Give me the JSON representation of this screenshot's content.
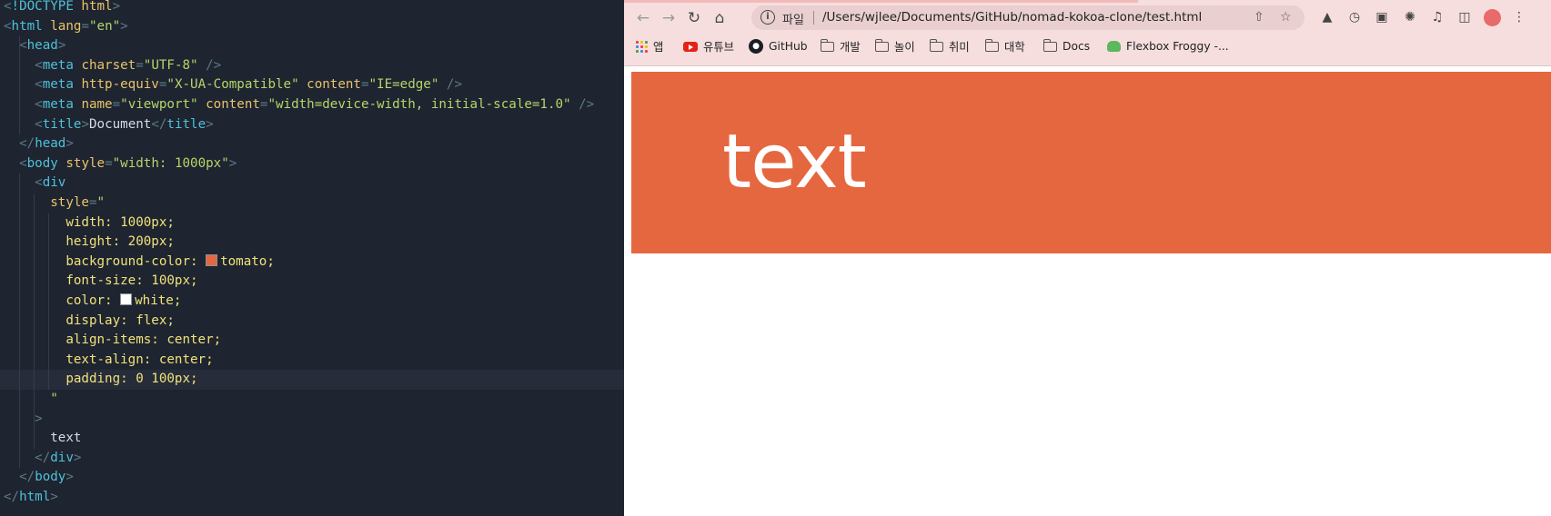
{
  "editor": {
    "lines": [
      [
        [
          "t-punc",
          "<"
        ],
        [
          "t-doctype",
          "!DOCTYPE "
        ],
        [
          "t-dtype-kw",
          "html"
        ],
        [
          "t-punc",
          ">"
        ]
      ],
      [
        [
          "t-punc",
          "<"
        ],
        [
          "t-tag",
          "html "
        ],
        [
          "t-attr",
          "lang"
        ],
        [
          "t-punc",
          "="
        ],
        [
          "t-str",
          "\"en\""
        ],
        [
          "t-punc",
          ">"
        ]
      ],
      [
        [
          "t-text",
          "  "
        ],
        [
          "t-punc",
          "<"
        ],
        [
          "t-tag",
          "head"
        ],
        [
          "t-punc",
          ">"
        ]
      ],
      [
        [
          "t-text",
          "    "
        ],
        [
          "t-punc",
          "<"
        ],
        [
          "t-tag",
          "meta "
        ],
        [
          "t-attr",
          "charset"
        ],
        [
          "t-punc",
          "="
        ],
        [
          "t-str",
          "\"UTF-8\" "
        ],
        [
          "t-punc",
          "/>"
        ]
      ],
      [
        [
          "t-text",
          "    "
        ],
        [
          "t-punc",
          "<"
        ],
        [
          "t-tag",
          "meta "
        ],
        [
          "t-attr",
          "http-equiv"
        ],
        [
          "t-punc",
          "="
        ],
        [
          "t-str",
          "\"X-UA-Compatible\" "
        ],
        [
          "t-attr",
          "content"
        ],
        [
          "t-punc",
          "="
        ],
        [
          "t-str",
          "\"IE=edge\" "
        ],
        [
          "t-punc",
          "/>"
        ]
      ],
      [
        [
          "t-text",
          "    "
        ],
        [
          "t-punc",
          "<"
        ],
        [
          "t-tag",
          "meta "
        ],
        [
          "t-attr",
          "name"
        ],
        [
          "t-punc",
          "="
        ],
        [
          "t-str",
          "\"viewport\" "
        ],
        [
          "t-attr",
          "content"
        ],
        [
          "t-punc",
          "="
        ],
        [
          "t-str",
          "\"width=device-width, initial-scale=1.0\" "
        ],
        [
          "t-punc",
          "/>"
        ]
      ],
      [
        [
          "t-text",
          "    "
        ],
        [
          "t-punc",
          "<"
        ],
        [
          "t-tag",
          "title"
        ],
        [
          "t-punc",
          ">"
        ],
        [
          "t-text",
          "Document"
        ],
        [
          "t-punc",
          "</"
        ],
        [
          "t-tag",
          "title"
        ],
        [
          "t-punc",
          ">"
        ]
      ],
      [
        [
          "t-text",
          "  "
        ],
        [
          "t-punc",
          "</"
        ],
        [
          "t-tag",
          "head"
        ],
        [
          "t-punc",
          ">"
        ]
      ],
      [
        [
          "t-text",
          "  "
        ],
        [
          "t-punc",
          "<"
        ],
        [
          "t-tag",
          "body "
        ],
        [
          "t-attr",
          "style"
        ],
        [
          "t-punc",
          "="
        ],
        [
          "t-str",
          "\"width: 1000px\""
        ],
        [
          "t-punc",
          ">"
        ]
      ],
      [
        [
          "t-text",
          "    "
        ],
        [
          "t-punc",
          "<"
        ],
        [
          "t-tag",
          "div"
        ]
      ],
      [
        [
          "t-text",
          "      "
        ],
        [
          "t-attr",
          "style"
        ],
        [
          "t-punc",
          "="
        ],
        [
          "t-str",
          "\""
        ]
      ],
      [
        [
          "t-text",
          "        "
        ],
        [
          "t-css",
          "width: 1000px;"
        ]
      ],
      [
        [
          "t-text",
          "        "
        ],
        [
          "t-css",
          "height: 200px;"
        ]
      ],
      [
        [
          "t-text",
          "        "
        ],
        [
          "t-css",
          "background-color: "
        ],
        [
          "swatch",
          "#e5673f"
        ],
        [
          "t-css",
          "tomato;"
        ]
      ],
      [
        [
          "t-text",
          "        "
        ],
        [
          "t-css",
          "font-size: 100px;"
        ]
      ],
      [
        [
          "t-text",
          "        "
        ],
        [
          "t-css",
          "color: "
        ],
        [
          "swatch",
          "#ffffff"
        ],
        [
          "t-css",
          "white;"
        ]
      ],
      [
        [
          "t-text",
          "        "
        ],
        [
          "t-css",
          "display: flex;"
        ]
      ],
      [
        [
          "t-text",
          "        "
        ],
        [
          "t-css",
          "align-items: center;"
        ]
      ],
      [
        [
          "t-text",
          "        "
        ],
        [
          "t-css",
          "text-align: center;"
        ]
      ],
      [
        [
          "t-text",
          "        "
        ],
        [
          "t-css",
          "padding: 0 100px;"
        ]
      ],
      [
        [
          "t-text",
          "      "
        ],
        [
          "t-str",
          "\""
        ]
      ],
      [
        [
          "t-text",
          "    "
        ],
        [
          "t-punc",
          ">"
        ]
      ],
      [
        [
          "t-text",
          "      text"
        ]
      ],
      [
        [
          "t-text",
          "    "
        ],
        [
          "t-punc",
          "</"
        ],
        [
          "t-tag",
          "div"
        ],
        [
          "t-punc",
          ">"
        ]
      ],
      [
        [
          "t-text",
          "  "
        ],
        [
          "t-punc",
          "</"
        ],
        [
          "t-tag",
          "body"
        ],
        [
          "t-punc",
          ">"
        ]
      ],
      [
        [
          "t-punc",
          "</"
        ],
        [
          "t-tag",
          "html"
        ],
        [
          "t-punc",
          ">"
        ]
      ]
    ],
    "active_line": 19
  },
  "browser": {
    "nav": {
      "back_icon": "back-arrow-icon",
      "forward_icon": "forward-arrow-icon",
      "reload_icon": "reload-icon",
      "home_icon": "home-icon"
    },
    "omnibox": {
      "scheme_label": "파일",
      "url": "/Users/wjlee/Documents/GitHub/nomad-kokoa-clone/test.html"
    },
    "bookmarks": [
      {
        "label": "앱",
        "icon": "apps-grid-icon"
      },
      {
        "label": "유튜브",
        "icon": "youtube-icon"
      },
      {
        "label": "GitHub",
        "icon": "github-icon"
      },
      {
        "label": "개발",
        "icon": "folder-icon"
      },
      {
        "label": "놀이",
        "icon": "folder-icon"
      },
      {
        "label": "취미",
        "icon": "folder-icon"
      },
      {
        "label": "대학",
        "icon": "folder-icon"
      },
      {
        "label": "Docs",
        "icon": "folder-icon"
      },
      {
        "label": "Flexbox Froggy -...",
        "icon": "froggy-icon"
      }
    ],
    "page": {
      "box_text": "text",
      "box_color": "#e5673f",
      "text_color": "#ffffff"
    }
  }
}
